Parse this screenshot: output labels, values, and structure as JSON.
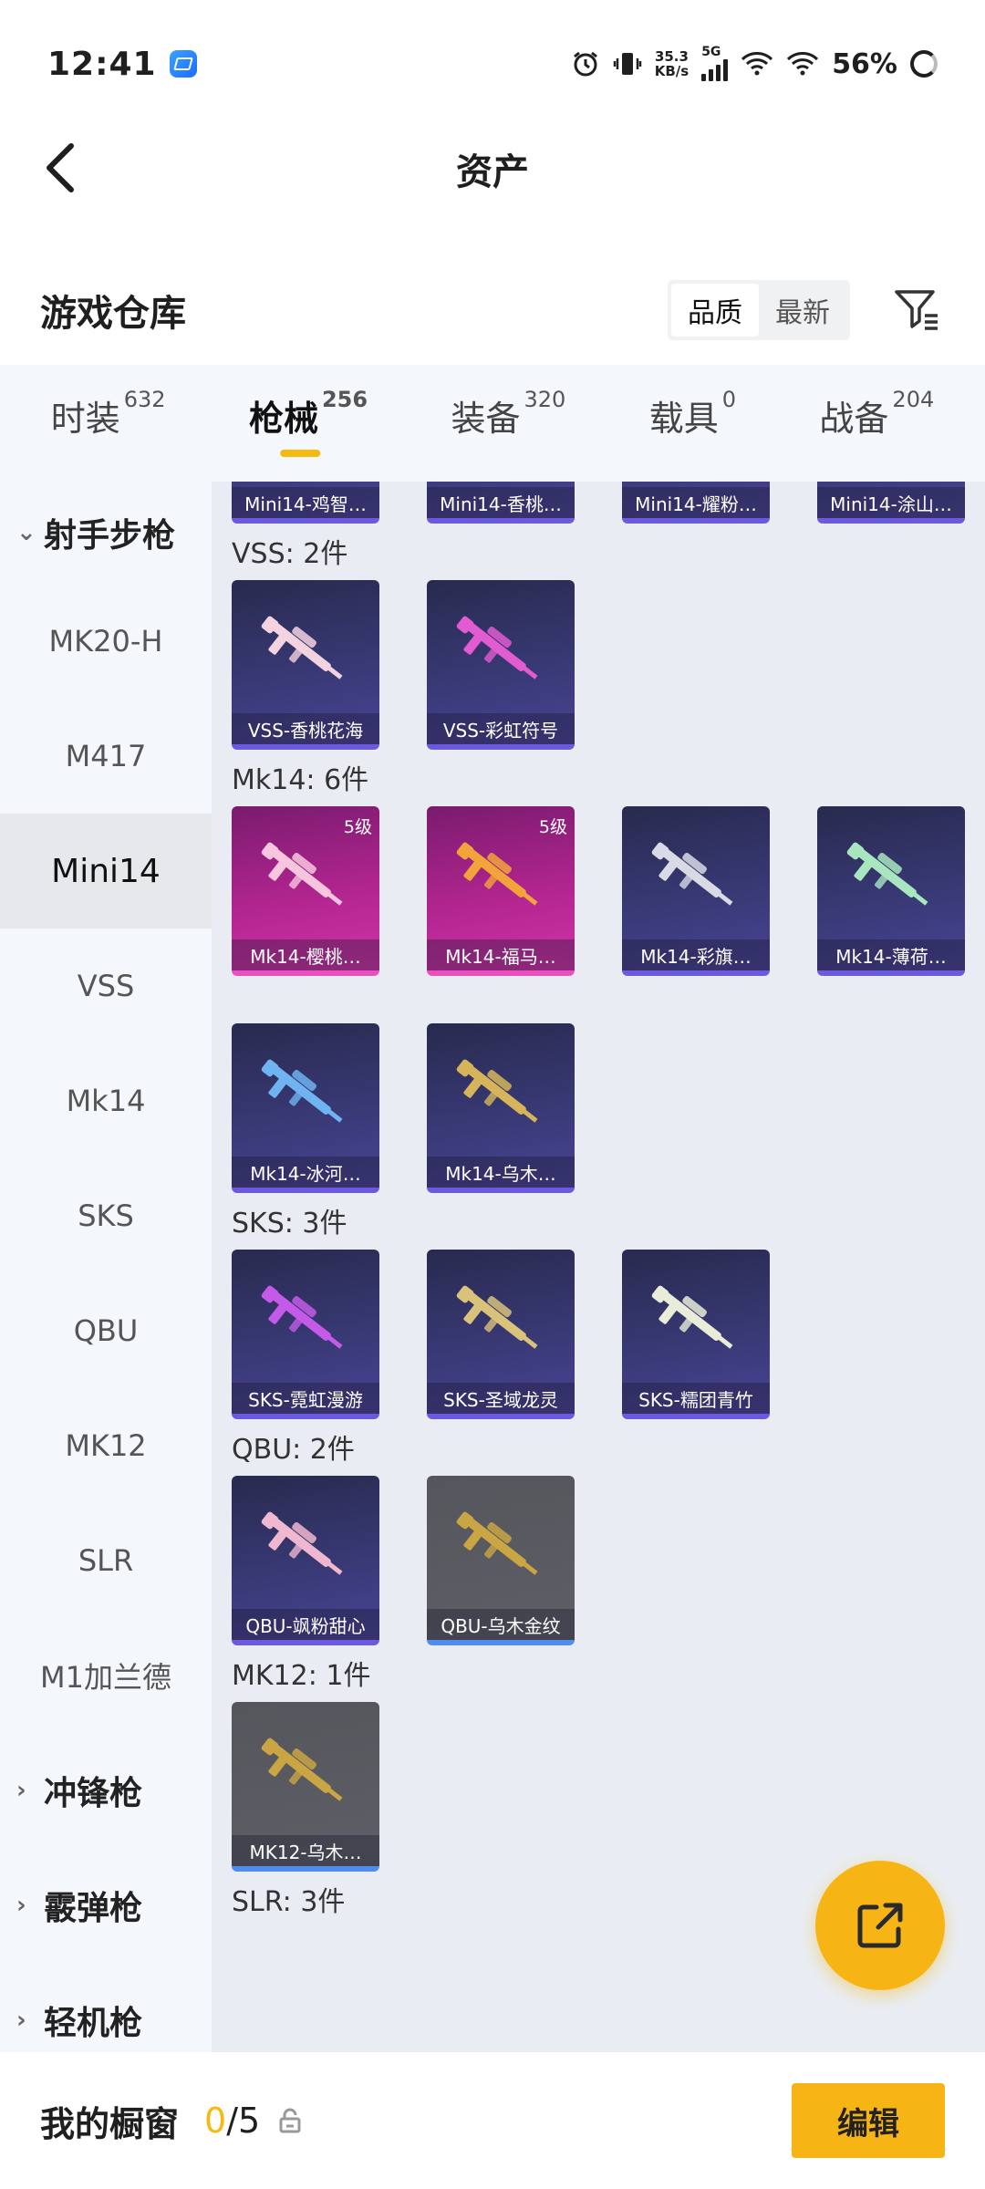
{
  "status_bar": {
    "time": "12:41",
    "net_speed_value": "35.3",
    "net_speed_unit": "KB/s",
    "network_type": "5G",
    "battery": "56%"
  },
  "header": {
    "title": "资产"
  },
  "warehouse": {
    "title": "游戏仓库",
    "sort_options": [
      "品质",
      "最新"
    ],
    "active_sort": "品质"
  },
  "tabs": [
    {
      "label": "时装",
      "count": "632"
    },
    {
      "label": "枪械",
      "count": "256"
    },
    {
      "label": "装备",
      "count": "320"
    },
    {
      "label": "载具",
      "count": "0"
    },
    {
      "label": "战备",
      "count": "204"
    }
  ],
  "active_tab": "枪械",
  "sidebar": {
    "groups": [
      {
        "label": "射手步枪",
        "expanded": true
      },
      {
        "label": "冲锋枪",
        "expanded": false
      },
      {
        "label": "霰弹枪",
        "expanded": false
      },
      {
        "label": "轻机枪",
        "expanded": false
      }
    ],
    "items": [
      "MK20-H",
      "M417",
      "Mini14",
      "VSS",
      "Mk14",
      "SKS",
      "QBU",
      "MK12",
      "SLR",
      "M1加兰德"
    ],
    "active_item": "Mini14"
  },
  "content": {
    "top_partial_cards": [
      "Mini14-鸡智…",
      "Mini14-香桃…",
      "Mini14-耀粉…",
      "Mini14-涂山…"
    ],
    "sections": [
      {
        "label": "VSS: 2件",
        "cards": [
          {
            "name": "VSS-香桃花海",
            "style": "purple",
            "gun_color": "#f3d3e0"
          },
          {
            "name": "VSS-彩虹符号",
            "style": "purple",
            "gun_color": "#e25bd0"
          }
        ]
      },
      {
        "label": "Mk14: 6件",
        "cards": [
          {
            "name": "Mk14-樱桃…",
            "style": "pink",
            "level": "5级",
            "gun_color": "#f7c6de"
          },
          {
            "name": "Mk14-福马…",
            "style": "pink",
            "level": "5级",
            "gun_color": "#f2a43a"
          },
          {
            "name": "Mk14-彩旗…",
            "style": "purple",
            "gun_color": "#d8dbe6"
          },
          {
            "name": "Mk14-薄荷…",
            "style": "purple",
            "gun_color": "#a8e6c0"
          },
          {
            "name": "Mk14-冰河…",
            "style": "purple",
            "gun_color": "#6fb3f0"
          },
          {
            "name": "Mk14-乌木…",
            "style": "purple",
            "gun_color": "#d6b55a"
          }
        ]
      },
      {
        "label": "SKS: 3件",
        "cards": [
          {
            "name": "SKS-霓虹漫游",
            "style": "purple",
            "gun_color": "#c45be8"
          },
          {
            "name": "SKS-圣域龙灵",
            "style": "purple",
            "gun_color": "#d9c27a"
          },
          {
            "name": "SKS-糯团青竹",
            "style": "purple",
            "gun_color": "#e8ecd8"
          }
        ]
      },
      {
        "label": "QBU: 2件",
        "cards": [
          {
            "name": "QBU-飒粉甜心",
            "style": "purple",
            "gun_color": "#f0b8cf"
          },
          {
            "name": "QBU-乌木金纹",
            "style": "gray",
            "gun_color": "#c9a544"
          }
        ]
      },
      {
        "label": "MK12: 1件",
        "cards": [
          {
            "name": "MK12-乌木…",
            "style": "gray",
            "gun_color": "#c9a544"
          }
        ]
      },
      {
        "label": "SLR: 3件",
        "cards": []
      }
    ]
  },
  "bottom_bar": {
    "title": "我的橱窗",
    "used": "0",
    "total": "/5",
    "edit_label": "编辑"
  },
  "colors": {
    "accent": "#f7b515",
    "card_purple": "#3a3a78",
    "card_pink": "#b1258f",
    "card_gray": "#5e5f66"
  }
}
